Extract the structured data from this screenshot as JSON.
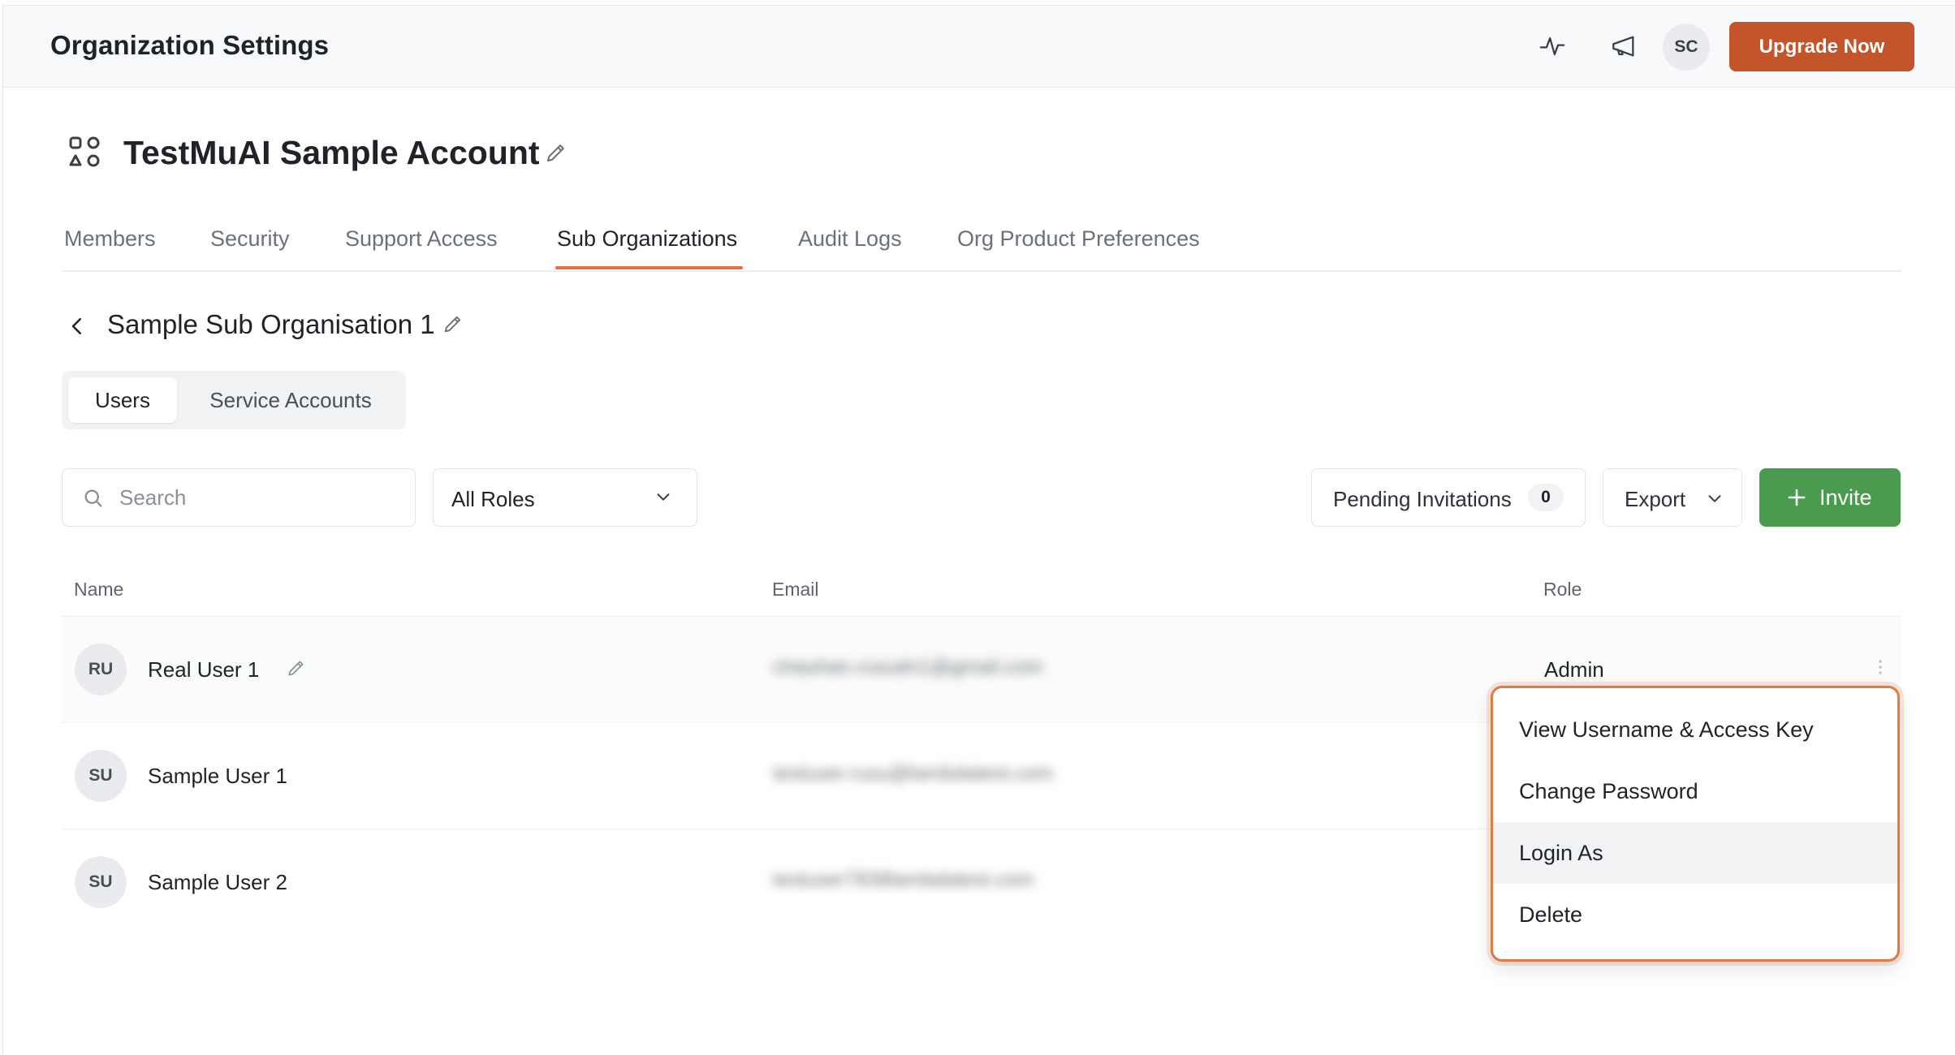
{
  "header": {
    "title": "Organization Settings",
    "activity_icon": "activity-icon",
    "announce_icon": "megaphone-icon",
    "avatar_initials": "SC",
    "upgrade_label": "Upgrade Now",
    "upgrade_color": "#c4542a"
  },
  "account": {
    "icon": "shapes-icon",
    "name": "TestMuAI Sample Account"
  },
  "tabs": [
    {
      "label": "Members",
      "active": false
    },
    {
      "label": "Security",
      "active": false
    },
    {
      "label": "Support Access",
      "active": false
    },
    {
      "label": "Sub Organizations",
      "active": true
    },
    {
      "label": "Audit Logs",
      "active": false
    },
    {
      "label": "Org Product Preferences",
      "active": false
    }
  ],
  "sub_org": {
    "name": "Sample Sub Organisation 1"
  },
  "segments": [
    {
      "label": "Users",
      "active": true
    },
    {
      "label": "Service Accounts",
      "active": false
    }
  ],
  "filters": {
    "search_placeholder": "Search",
    "role_value": "All Roles",
    "pending_label": "Pending Invitations",
    "pending_count": "0",
    "export_label": "Export",
    "invite_label": "Invite",
    "invite_color": "#4a9b50"
  },
  "table": {
    "columns": [
      "Name",
      "Email",
      "Role"
    ],
    "rows": [
      {
        "initials": "RU",
        "name": "Real User 1",
        "email": "chauhan.rusudn1@gmail.com",
        "role": "Admin"
      },
      {
        "initials": "SU",
        "name": "Sample User 1",
        "email": "testuser.rusu@lambdatest.com",
        "role": ""
      },
      {
        "initials": "SU",
        "name": "Sample User 2",
        "email": "testuser7838lambdatest.com",
        "role": ""
      }
    ]
  },
  "context_menu": {
    "items": [
      {
        "label": "View Username & Access Key"
      },
      {
        "label": "Change Password"
      },
      {
        "label": "Login As"
      },
      {
        "label": "Delete"
      }
    ],
    "highlighted_index": 2,
    "accent_color": "#e27a46"
  }
}
